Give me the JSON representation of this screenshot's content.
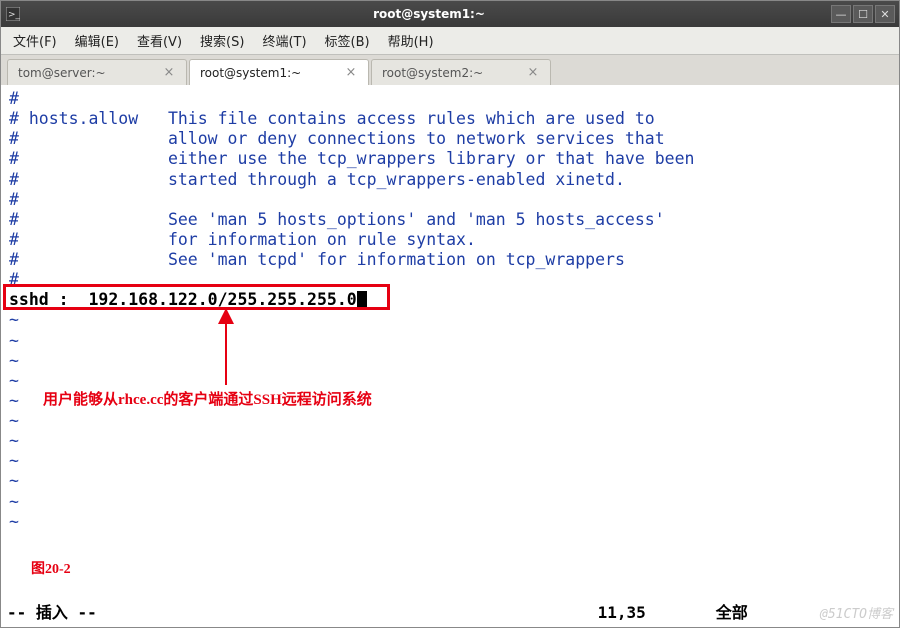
{
  "window": {
    "title": "root@system1:~"
  },
  "menu": {
    "file": "文件(F)",
    "edit": "编辑(E)",
    "view": "查看(V)",
    "search": "搜索(S)",
    "terminal": "终端(T)",
    "tabs": "标签(B)",
    "help": "帮助(H)"
  },
  "tabs": [
    {
      "label": "tom@server:~",
      "active": false
    },
    {
      "label": "root@system1:~",
      "active": true
    },
    {
      "label": "root@system2:~",
      "active": false
    }
  ],
  "file": {
    "l1": "#",
    "l2": "# hosts.allow   This file contains access rules which are used to",
    "l3": "#               allow or deny connections to network services that",
    "l4": "#               either use the tcp_wrappers library or that have been",
    "l5": "#               started through a tcp_wrappers-enabled xinetd.",
    "l6": "#",
    "l7": "#               See 'man 5 hosts_options' and 'man 5 hosts_access'",
    "l8": "#               for information on rule syntax.",
    "l9": "#               See 'man tcpd' for information on tcp_wrappers",
    "l10": "#",
    "rule": "sshd :  192.168.122.0/255.255.255.0"
  },
  "annotation": {
    "text": "用户能够从rhce.cc的客户端通过SSH远程访问系统",
    "figure": "图20-2"
  },
  "status": {
    "mode": "-- 插入 --",
    "pos": "11,35",
    "pct": "全部"
  },
  "watermark": "@51CTO博客"
}
